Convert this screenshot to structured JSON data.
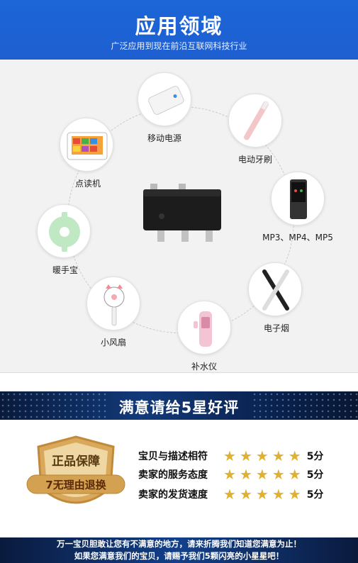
{
  "header": {
    "title": "应用领域",
    "subtitle": "广泛应用到现在前沿互联网科技行业"
  },
  "applications": [
    {
      "label": "移动电源",
      "icon": "power-bank-icon"
    },
    {
      "label": "电动牙刷",
      "icon": "electric-toothbrush-icon"
    },
    {
      "label": "点读机",
      "icon": "reading-pen-tablet-icon"
    },
    {
      "label": "MP3、MP4、MP5",
      "icon": "mp3-player-icon"
    },
    {
      "label": "暖手宝",
      "icon": "hand-warmer-icon"
    },
    {
      "label": "电子烟",
      "icon": "e-cigarette-icon"
    },
    {
      "label": "小风扇",
      "icon": "mini-fan-icon"
    },
    {
      "label": "补水仪",
      "icon": "mist-sprayer-icon"
    }
  ],
  "banner": {
    "title": "满意请给5星好评"
  },
  "badge": {
    "line1": "正品保障",
    "line2": "7无理由退换"
  },
  "ratings": [
    {
      "label": "宝贝与描述相符",
      "stars": 5,
      "score": "5分"
    },
    {
      "label": "卖家的服务态度",
      "stars": 5,
      "score": "5分"
    },
    {
      "label": "卖家的发货速度",
      "stars": 5,
      "score": "5分"
    }
  ],
  "footer": {
    "line1": "万一宝贝胆敢让您有不满意的地方，请来折腾我们知道您满意为止！",
    "line2": "如果您满意我们的宝贝，请赐予我们5颗闪亮的小星星吧！"
  },
  "colors": {
    "header_blue": "#1e62d6",
    "star_gold": "#e0b030",
    "band_navy": "#0b2555"
  }
}
